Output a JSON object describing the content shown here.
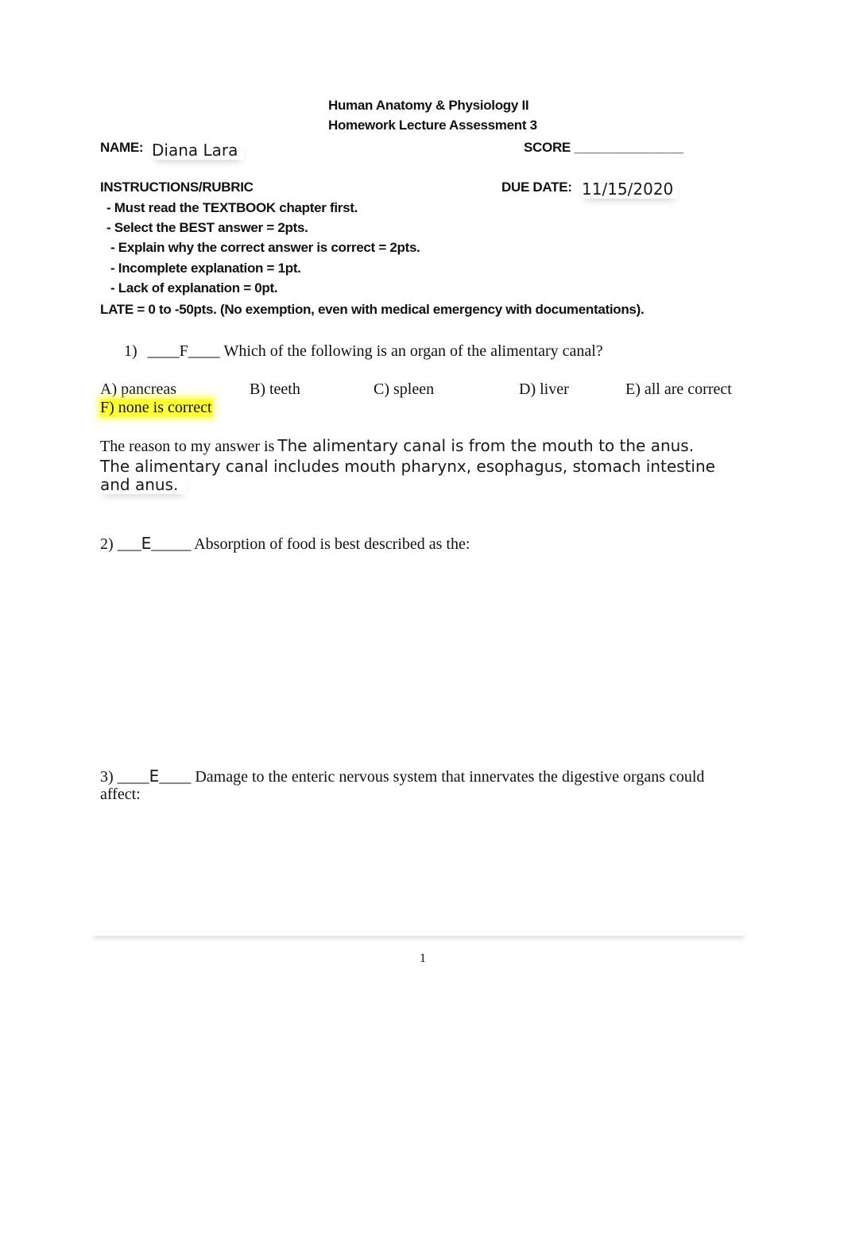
{
  "header": {
    "course_title": "Human Anatomy & Physiology II",
    "assessment_title": "Homework Lecture Assessment 3"
  },
  "student": {
    "name_label": "NAME:",
    "name_value": "Diana Lara",
    "score_label": "SCORE",
    "score_blank": "_______________",
    "due_label": "DUE DATE:",
    "due_value": "11/15/2020"
  },
  "instructions": {
    "heading": "INSTRUCTIONS/RUBRIC",
    "items": [
      "- Must read the TEXTBOOK chapter first.",
      "- Select the BEST answer = 2pts.",
      "- Explain why the correct answer is correct = 2pts.",
      "- Incomplete explanation = 1pt.",
      "- Lack of explanation = 0pt."
    ],
    "late_policy": "LATE = 0 to -50pts. (No exemption, even with medical emergency with documentations)."
  },
  "questions": [
    {
      "number": "1)",
      "blank_before": "____",
      "answer": "F",
      "blank_after": "____",
      "text": "Which of the following is an organ of the alimentary canal?",
      "options": [
        {
          "label": "A) pancreas",
          "selected": false
        },
        {
          "label": "B) teeth",
          "selected": false
        },
        {
          "label": "C) spleen",
          "selected": false
        },
        {
          "label": "D) liver",
          "selected": false
        },
        {
          "label": "E) all are correct",
          "selected": false
        },
        {
          "label": "F) none is correct",
          "selected": true
        }
      ],
      "reason_prefix": "The reason to my answer is",
      "reason_lines": [
        "The alimentary canal is from the mouth to the anus.",
        "The alimentary canal includes mouth pharynx, esophagus, stomach intestine",
        "and anus."
      ]
    },
    {
      "number": "2)",
      "blank_before": "___",
      "answer": "E",
      "blank_after": "_____",
      "text": "Absorption of food is best described as the:"
    },
    {
      "number": "3)",
      "blank_before": "____",
      "answer": "E",
      "blank_after": "____",
      "text_line1": "Damage to the enteric nervous system that innervates the digestive organs could",
      "text_line2": "affect:"
    }
  ],
  "footer": {
    "page_number": "1"
  },
  "colors": {
    "highlight": "#ffff33"
  }
}
